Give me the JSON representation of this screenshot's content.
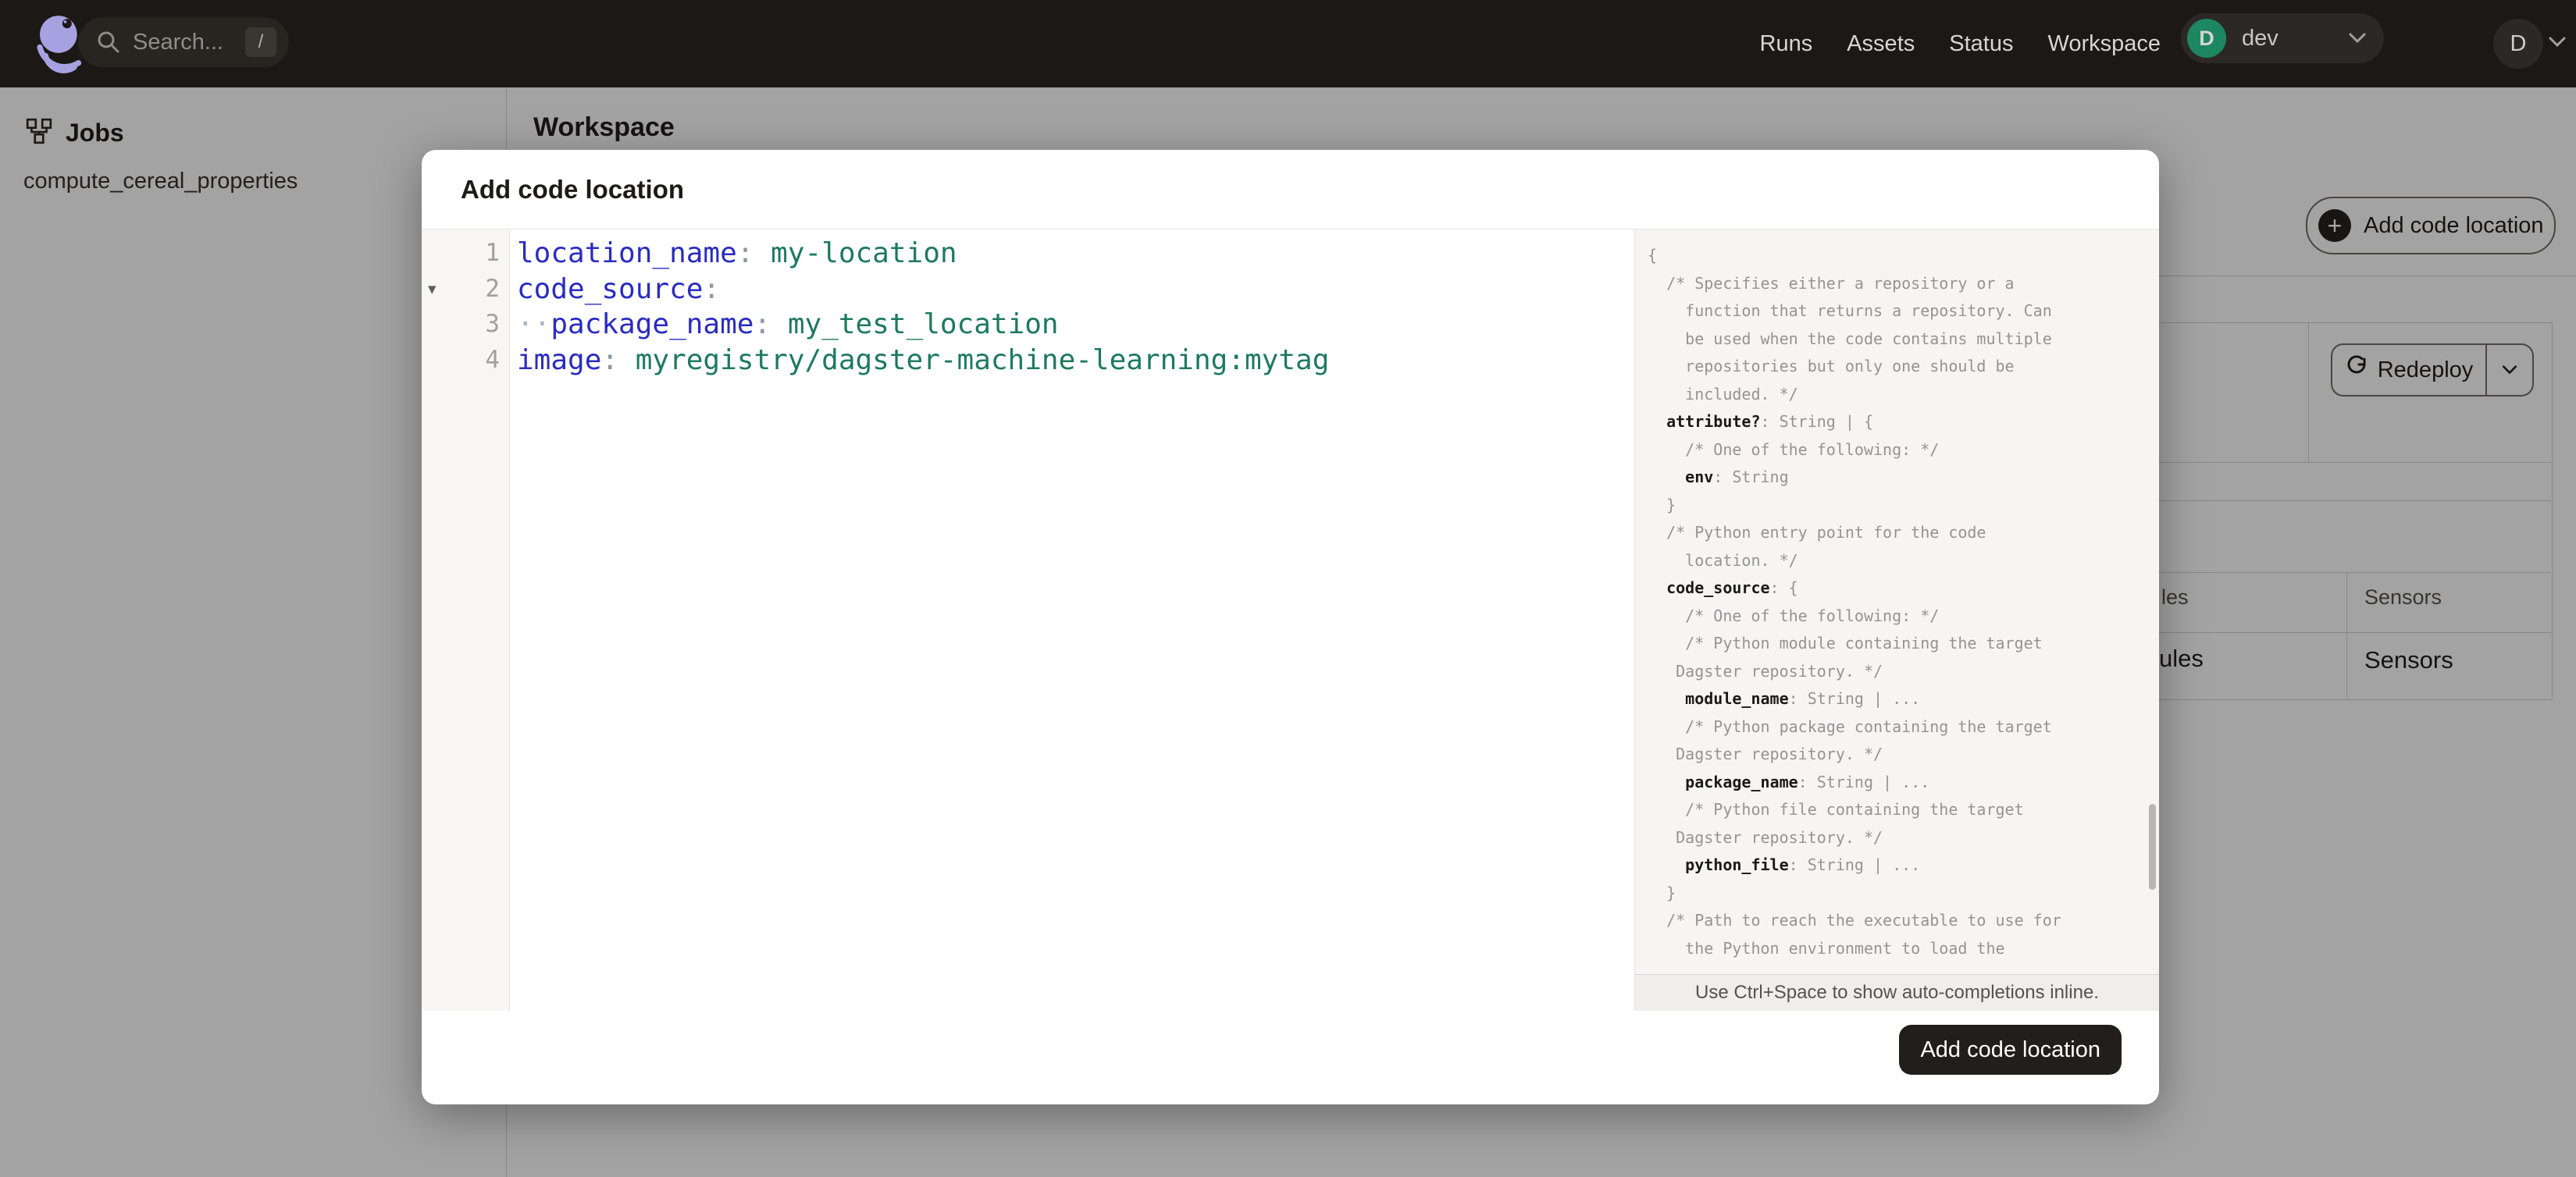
{
  "colors": {
    "nav_bg": "#1b1815",
    "logo_purple": "#a6a2e2",
    "deployment_green": "#1d8662",
    "yaml_key": "#2a2cc0",
    "yaml_value": "#1e7a5e",
    "submit_bg": "#211e1b",
    "backdrop": "rgba(0,0,0,0.36)"
  },
  "nav": {
    "search": {
      "placeholder": "Search...",
      "shortcut": "/"
    },
    "items": [
      {
        "label": "Runs"
      },
      {
        "label": "Assets"
      },
      {
        "label": "Status"
      },
      {
        "label": "Workspace"
      }
    ],
    "deployment": {
      "initial": "D",
      "name": "dev"
    },
    "user": {
      "initial": "D"
    }
  },
  "sidebar": {
    "title": "Jobs",
    "items": [
      {
        "label": "compute_cereal_properties"
      }
    ]
  },
  "workspace": {
    "title": "Workspace",
    "add_code_location_label": "Add code location",
    "redeploy_label": "Redeploy",
    "table": {
      "header_fragment_left": "les",
      "header_right": "Sensors",
      "cell_fragment_left": "ules",
      "cell_right": "Sensors"
    }
  },
  "modal": {
    "title": "Add code location",
    "submit_label": "Add code location",
    "hint": "Use Ctrl+Space to show auto-completions inline.",
    "editor_lines": [
      {
        "num": "1",
        "segs": [
          {
            "cls": "k",
            "t": "location_name"
          },
          {
            "cls": "p",
            "t": ":"
          },
          {
            "cls": "v",
            "t": " my-location"
          }
        ]
      },
      {
        "num": "2",
        "fold": "▾",
        "segs": [
          {
            "cls": "k",
            "t": "code_source"
          },
          {
            "cls": "p",
            "t": ":"
          }
        ]
      },
      {
        "num": "3",
        "segs": [
          {
            "cls": "d",
            "t": "··"
          },
          {
            "cls": "k",
            "t": "package_name"
          },
          {
            "cls": "p",
            "t": ":"
          },
          {
            "cls": "v",
            "t": " my_test_location"
          }
        ]
      },
      {
        "num": "4",
        "segs": [
          {
            "cls": "k",
            "t": "image"
          },
          {
            "cls": "p",
            "t": ":"
          },
          {
            "cls": "v",
            "t": " myregistry/dagster-machine-learning:mytag"
          }
        ]
      }
    ],
    "schema_lines": [
      {
        "segs": [
          {
            "cls": "sd",
            "t": "{"
          }
        ]
      },
      {
        "segs": [
          {
            "cls": "sd",
            "t": "  /* Specifies either a repository or a"
          }
        ]
      },
      {
        "segs": [
          {
            "cls": "sd",
            "t": "    function that returns a repository. Can"
          }
        ]
      },
      {
        "segs": [
          {
            "cls": "sd",
            "t": "    be used when the code contains multiple"
          }
        ]
      },
      {
        "segs": [
          {
            "cls": "sd",
            "t": "    repositories but only one should be"
          }
        ]
      },
      {
        "segs": [
          {
            "cls": "sd",
            "t": "    included. */"
          }
        ]
      },
      {
        "segs": [
          {
            "cls": "sd",
            "t": "  "
          },
          {
            "cls": "sk",
            "t": "attribute?"
          },
          {
            "cls": "sd",
            "t": ": String | {"
          }
        ]
      },
      {
        "segs": [
          {
            "cls": "sd",
            "t": "    /* One of the following: */"
          }
        ]
      },
      {
        "segs": [
          {
            "cls": "sd",
            "t": "    "
          },
          {
            "cls": "sk",
            "t": "env"
          },
          {
            "cls": "sd",
            "t": ": String"
          }
        ]
      },
      {
        "segs": [
          {
            "cls": "sd",
            "t": "  }"
          }
        ]
      },
      {
        "segs": [
          {
            "cls": "sd",
            "t": "  /* Python entry point for the code"
          }
        ]
      },
      {
        "segs": [
          {
            "cls": "sd",
            "t": "    location. */"
          }
        ]
      },
      {
        "segs": [
          {
            "cls": "sd",
            "t": "  "
          },
          {
            "cls": "sk",
            "t": "code_source"
          },
          {
            "cls": "sd",
            "t": ": {"
          }
        ]
      },
      {
        "segs": [
          {
            "cls": "sd",
            "t": "    /* One of the following: */"
          }
        ]
      },
      {
        "segs": [
          {
            "cls": "sd",
            "t": "    /* Python module containing the target"
          }
        ]
      },
      {
        "segs": [
          {
            "cls": "sd",
            "t": "   Dagster repository. */"
          }
        ]
      },
      {
        "segs": [
          {
            "cls": "sd",
            "t": "    "
          },
          {
            "cls": "sk",
            "t": "module_name"
          },
          {
            "cls": "sd",
            "t": ": String | ..."
          }
        ]
      },
      {
        "segs": [
          {
            "cls": "sd",
            "t": "    /* Python package containing the target"
          }
        ]
      },
      {
        "segs": [
          {
            "cls": "sd",
            "t": "   Dagster repository. */"
          }
        ]
      },
      {
        "segs": [
          {
            "cls": "sd",
            "t": "    "
          },
          {
            "cls": "sk",
            "t": "package_name"
          },
          {
            "cls": "sd",
            "t": ": String | ..."
          }
        ]
      },
      {
        "segs": [
          {
            "cls": "sd",
            "t": "    /* Python file containing the target"
          }
        ]
      },
      {
        "segs": [
          {
            "cls": "sd",
            "t": "   Dagster repository. */"
          }
        ]
      },
      {
        "segs": [
          {
            "cls": "sd",
            "t": "    "
          },
          {
            "cls": "sk",
            "t": "python_file"
          },
          {
            "cls": "sd",
            "t": ": String | ..."
          }
        ]
      },
      {
        "segs": [
          {
            "cls": "sd",
            "t": "  }"
          }
        ]
      },
      {
        "segs": [
          {
            "cls": "sd",
            "t": "  /* Path to reach the executable to use for"
          }
        ]
      },
      {
        "segs": [
          {
            "cls": "sd",
            "t": "    the Python environment to load the"
          }
        ]
      }
    ]
  }
}
